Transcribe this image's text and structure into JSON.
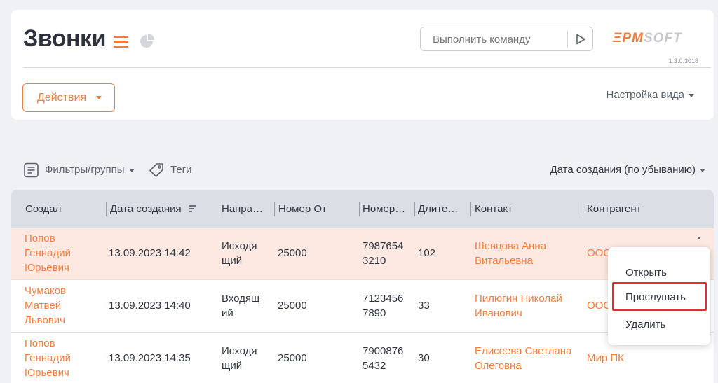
{
  "header": {
    "title": "Звонки",
    "command_placeholder": "Выполнить команду",
    "logo": {
      "primary": "ΞPM",
      "secondary": "SOFT"
    },
    "version": "1.3.0.3018",
    "actions_label": "Действия",
    "view_settings_label": "Настройка вида"
  },
  "toolbar": {
    "filters_label": "Фильтры/группы",
    "tags_label": "Теги",
    "sort_label": "Дата создания (по убыванию)"
  },
  "table": {
    "columns": [
      "Создал",
      "Дата создания",
      "Напра…",
      "Номер От",
      "Номер…",
      "Длите…",
      "Контакт",
      "Контрагент"
    ],
    "rows": [
      {
        "created_by": "Попов\nГеннадий\nЮрьевич",
        "date": "13.09.2023 14:42",
        "direction": "Исходя\nщий",
        "from": "25000",
        "to": "7987654\n3210",
        "duration": "102",
        "contact": "Шевцова Анна\nВитальевна",
        "account": "ООО"
      },
      {
        "created_by": "Чумаков\nМатвей\nЛьвович",
        "date": "13.09.2023 14:40",
        "direction": "Входящ\nий",
        "from": "25000",
        "to": "7123456\n7890",
        "duration": "33",
        "contact": "Пилюгин Николай\nИванович",
        "account": "ООО"
      },
      {
        "created_by": "Попов\nГеннадий\nЮрьевич",
        "date": "13.09.2023 14:35",
        "direction": "Исходя\nщий",
        "from": "25000",
        "to": "7900876\n5432",
        "duration": "30",
        "contact": "Елисеева Светлана\nОлеговна",
        "account": "Мир ПК"
      }
    ]
  },
  "context_menu": {
    "items": [
      "Открыть",
      "Прослушать",
      "Удалить"
    ]
  },
  "colors": {
    "accent": "#f47c3c",
    "selected_row": "#fde9e1",
    "highlight_border": "#e52d2d",
    "header_bg": "#dbdee5"
  }
}
